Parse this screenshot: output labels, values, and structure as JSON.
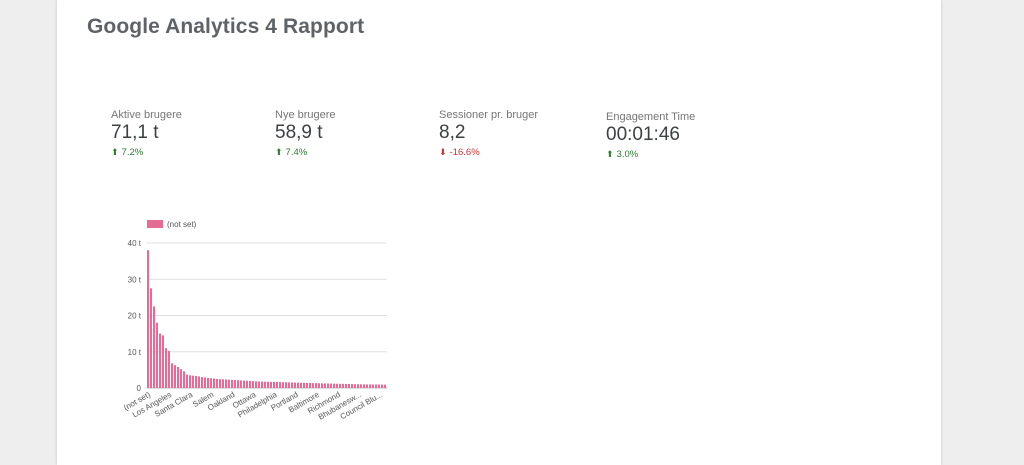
{
  "report": {
    "title": "Google Analytics 4 Rapport"
  },
  "kpis": [
    {
      "label": "Aktive brugere",
      "value": "71,1 t",
      "delta": "7.2%",
      "direction": "up"
    },
    {
      "label": "Nye brugere",
      "value": "58,9 t",
      "delta": "7.4%",
      "direction": "up"
    },
    {
      "label": "Sessioner pr. bruger",
      "value": "8,2",
      "delta": "-16.6%",
      "direction": "down"
    },
    {
      "label": "Engagement Time",
      "value": "00:01:46",
      "delta": "3.0%",
      "direction": "up"
    }
  ],
  "colors": {
    "bar": "#e86a96",
    "up": "#2e7d32",
    "down": "#d32f2f"
  },
  "chart_data": {
    "type": "bar",
    "legend": "(not set)",
    "legend_position": "top-left",
    "grid": true,
    "ylim": [
      0,
      40000
    ],
    "yticks": [
      "0",
      "10 t",
      "20 t",
      "30 t",
      "40 t"
    ],
    "x_tick_labels": [
      "(not set)",
      "Los Angeles",
      "Santa Clara",
      "Salem",
      "Oakland",
      "Ottawa",
      "Philadelphia",
      "Portland",
      "Baltimore",
      "Richmond",
      "Bhubanesw...",
      "Council Blu..."
    ],
    "values": [
      38000,
      27500,
      22500,
      18000,
      15000,
      14500,
      11000,
      10200,
      6800,
      6300,
      5800,
      5200,
      4600,
      3700,
      3500,
      3400,
      3300,
      3200,
      3000,
      2900,
      2800,
      2700,
      2600,
      2500,
      2450,
      2400,
      2350,
      2300,
      2250,
      2200,
      2150,
      2100,
      2050,
      2000,
      1950,
      1900,
      1850,
      1800,
      1780,
      1750,
      1720,
      1700,
      1680,
      1650,
      1620,
      1600,
      1580,
      1550,
      1520,
      1500,
      1480,
      1450,
      1430,
      1400,
      1380,
      1350,
      1330,
      1300,
      1280,
      1260,
      1240,
      1220,
      1200,
      1180,
      1160,
      1140,
      1120,
      1100,
      1080,
      1060,
      1040,
      1020,
      1000,
      990,
      980,
      970,
      960,
      950,
      940,
      930
    ]
  }
}
